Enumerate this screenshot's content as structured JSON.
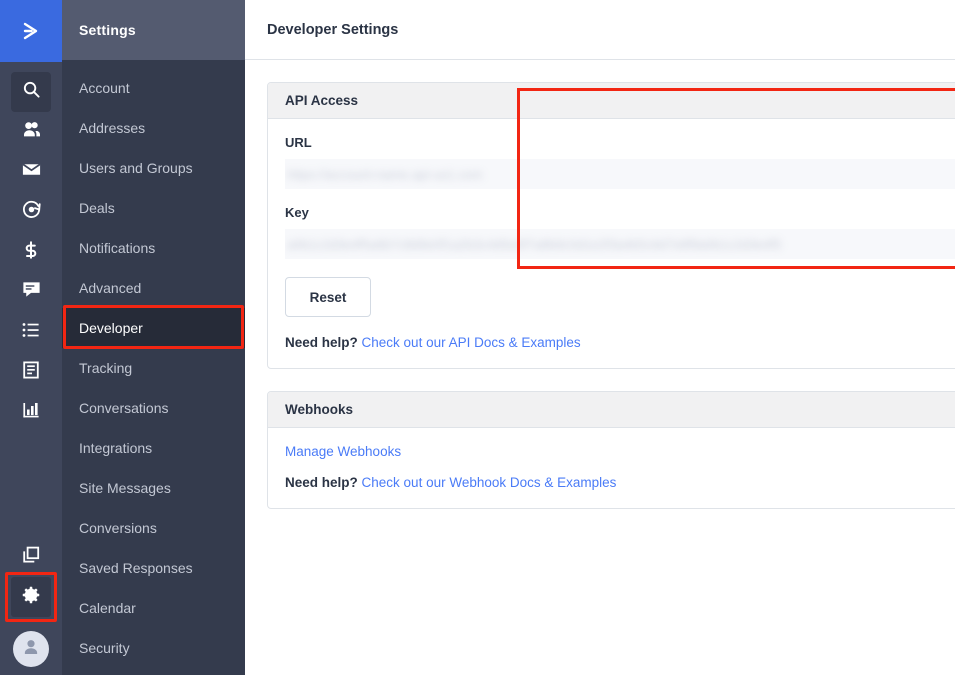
{
  "rail": {
    "logo_icon": "chevron-right-logo",
    "items": [
      {
        "icon": "search-icon",
        "name": "search",
        "active": true
      },
      {
        "icon": "contacts-icon",
        "name": "contacts",
        "active": false
      },
      {
        "icon": "campaigns-mail-icon",
        "name": "campaigns",
        "active": false
      },
      {
        "icon": "automations-icon",
        "name": "automations",
        "active": false
      },
      {
        "icon": "deals-dollar-icon",
        "name": "deals",
        "active": false
      },
      {
        "icon": "conversations-icon",
        "name": "conversations",
        "active": false
      },
      {
        "icon": "lists-icon",
        "name": "lists",
        "active": false
      },
      {
        "icon": "forms-icon",
        "name": "forms",
        "active": false
      },
      {
        "icon": "reports-bar-icon",
        "name": "reports",
        "active": false
      }
    ],
    "bottom": [
      {
        "icon": "apps-stack-icon",
        "name": "apps"
      },
      {
        "icon": "gear-icon",
        "name": "settings"
      }
    ],
    "avatar_icon": "user-avatar-icon"
  },
  "nav": {
    "title": "Settings",
    "items": [
      {
        "label": "Account",
        "active": false
      },
      {
        "label": "Addresses",
        "active": false
      },
      {
        "label": "Users and Groups",
        "active": false
      },
      {
        "label": "Deals",
        "active": false
      },
      {
        "label": "Notifications",
        "active": false
      },
      {
        "label": "Advanced",
        "active": false
      },
      {
        "label": "Developer",
        "active": true
      },
      {
        "label": "Tracking",
        "active": false
      },
      {
        "label": "Conversations",
        "active": false
      },
      {
        "label": "Integrations",
        "active": false
      },
      {
        "label": "Site Messages",
        "active": false
      },
      {
        "label": "Conversions",
        "active": false
      },
      {
        "label": "Saved Responses",
        "active": false
      },
      {
        "label": "Calendar",
        "active": false
      },
      {
        "label": "Security",
        "active": false
      }
    ]
  },
  "main": {
    "title": "Developer Settings",
    "api_panel": {
      "heading": "API Access",
      "url_label": "URL",
      "url_value": "https://account-name.api-us1.com",
      "key_label": "Key",
      "key_value": "a0b1c2d3e4f5a6b7c8d9e0f1a2b3c4d5e6f7a8b9c0d1e2f3a4b5c6d7e8f9a0b1c2d3e4f5",
      "reset_label": "Reset",
      "help_prefix": "Need help?",
      "help_link": "Check out our API Docs & Examples"
    },
    "webhooks_panel": {
      "heading": "Webhooks",
      "manage_link": "Manage Webhooks",
      "help_prefix": "Need help?",
      "help_link": "Check out our Webhook Docs & Examples"
    }
  },
  "colors": {
    "brand_blue": "#3a6ae0",
    "link_blue": "#4a7bf7",
    "rail_bg": "#3f465b",
    "nav_bg": "#343b4d",
    "nav_header_bg": "#545b70",
    "nav_active_bg": "#262b38",
    "highlight_red": "#f22613",
    "panel_head_bg": "#f1f1f2"
  }
}
